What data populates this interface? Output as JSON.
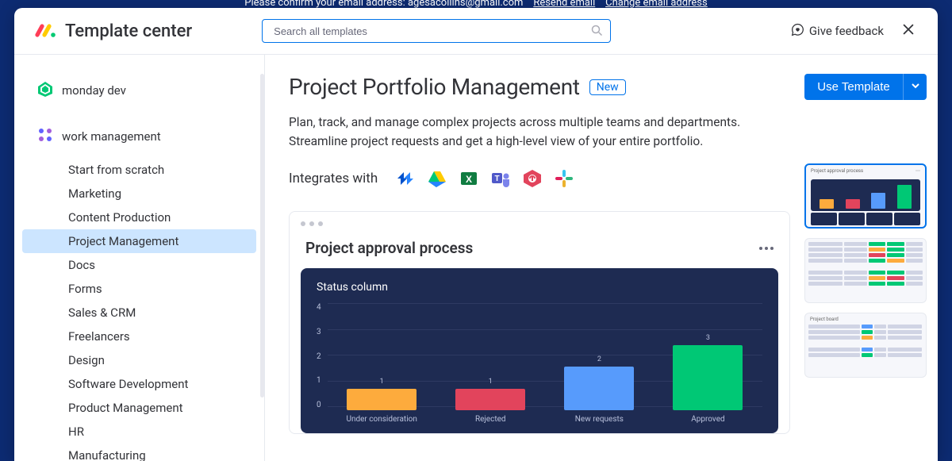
{
  "top_banner": {
    "text": "Please confirm your email address: agesacollins@gmail.com",
    "links": [
      "Resend email",
      "Change email address"
    ]
  },
  "header": {
    "title": "Template center",
    "search_placeholder": "Search all templates",
    "feedback": "Give feedback"
  },
  "sidebar": {
    "products": [
      {
        "name": "monday dev",
        "icon": "mondaydev"
      },
      {
        "name": "work management",
        "icon": "workmgmt"
      }
    ],
    "categories": [
      "Start from scratch",
      "Marketing",
      "Content Production",
      "Project Management",
      "Docs",
      "Forms",
      "Sales & CRM",
      "Freelancers",
      "Design",
      "Software Development",
      "Product Management",
      "HR",
      "Manufacturing"
    ],
    "active_index": 3
  },
  "main": {
    "title": "Project Portfolio Management",
    "badge": "New",
    "description": "Plan, track, and manage complex projects across multiple teams and departments. Streamline project requests and get a high-level view of your entire portfolio.",
    "integrates_label": "Integrates with",
    "use_template_label": "Use Template",
    "preview_title": "Project approval process",
    "preview_subtitle": "Status column"
  },
  "chart_data": {
    "type": "bar",
    "title": "Status column",
    "xlabel": "",
    "ylabel": "",
    "ylim": [
      0,
      4
    ],
    "yticks": [
      0,
      1,
      2,
      3,
      4
    ],
    "categories": [
      "Under consideration",
      "Rejected",
      "New requests",
      "Approved"
    ],
    "values": [
      1,
      1,
      2,
      3
    ],
    "colors": [
      "#fdab3d",
      "#e2445c",
      "#579bfc",
      "#00c875"
    ]
  },
  "thumbnails": {
    "labels": [
      "Project approval process",
      "",
      "Project board"
    ]
  }
}
